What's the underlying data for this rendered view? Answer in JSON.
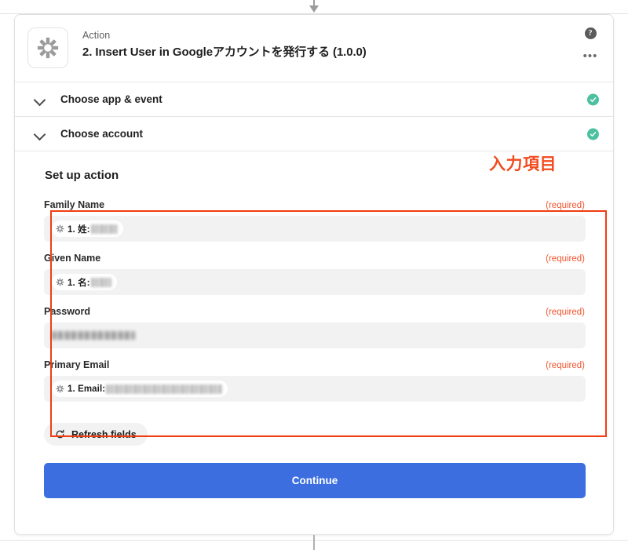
{
  "header": {
    "kicker": "Action",
    "title": "2. Insert User in Googleアカウントを発行する (1.0.0)",
    "help_icon": "help-circle-icon",
    "more_icon": "ellipsis-icon",
    "app_icon": "zapier-asterisk-icon"
  },
  "sections": [
    {
      "label": "Choose app & event",
      "state": "complete"
    },
    {
      "label": "Choose account",
      "state": "complete"
    }
  ],
  "setup": {
    "title": "Set up action",
    "annotation": "入力項目"
  },
  "fields": [
    {
      "label": "Family Name",
      "required_text": "(required)",
      "chip": "1. 姓:",
      "has_chip": true,
      "redacted_width": 34
    },
    {
      "label": "Given Name",
      "required_text": "(required)",
      "chip": "1. 名:",
      "has_chip": true,
      "redacted_width": 26
    },
    {
      "label": "Password",
      "required_text": "(required)",
      "chip": "",
      "has_chip": false,
      "redacted_width": 106
    },
    {
      "label": "Primary Email",
      "required_text": "(required)",
      "chip": "1. Email:",
      "has_chip": true,
      "redacted_width": 148
    }
  ],
  "buttons": {
    "refresh_label": "Refresh fields",
    "refresh_icon": "refresh-icon",
    "continue_label": "Continue"
  },
  "colors": {
    "accent_blue": "#3c6ee0",
    "annotation_red": "#f03d12",
    "required_orange": "#f2542d",
    "check_green": "#4dc0a0"
  }
}
